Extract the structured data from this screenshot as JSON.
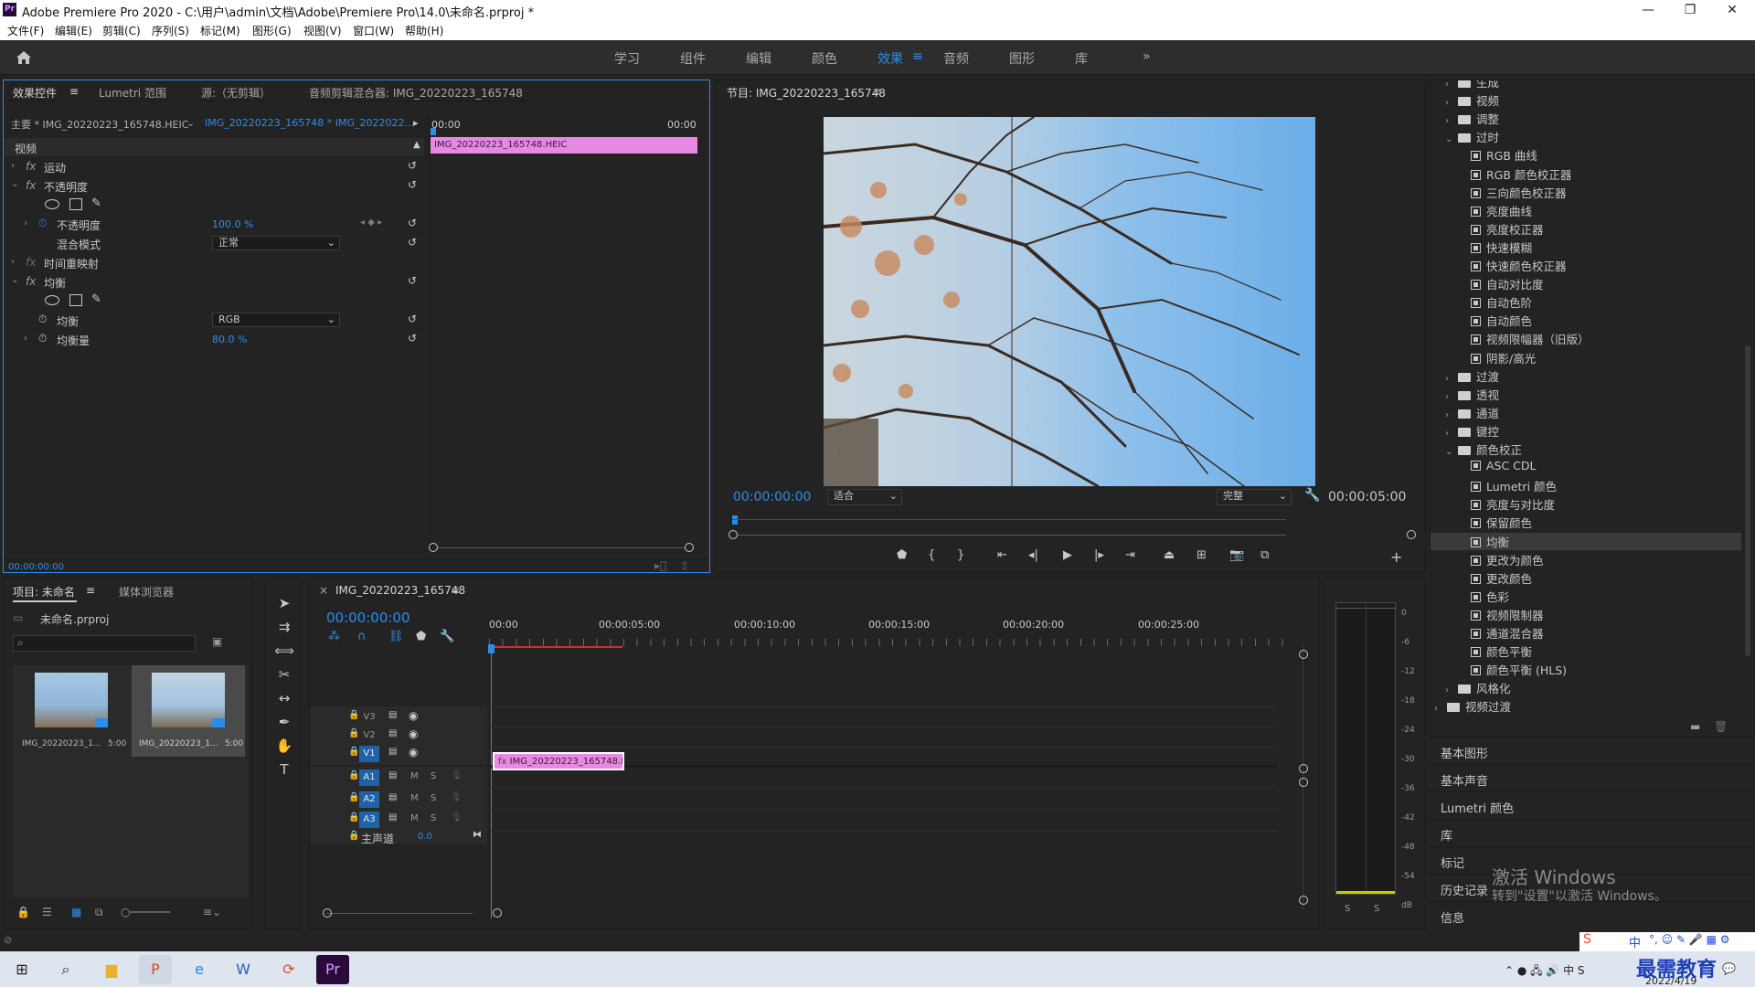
{
  "window": {
    "title": "Adobe Premiere Pro 2020 - C:\\用户\\admin\\文档\\Adobe\\Premiere Pro\\14.0\\未命名.prproj *",
    "app_icon": "Pr"
  },
  "menu": [
    "文件(F)",
    "编辑(E)",
    "剪辑(C)",
    "序列(S)",
    "标记(M)",
    "图形(G)",
    "视图(V)",
    "窗口(W)",
    "帮助(H)"
  ],
  "workspaces": {
    "items": [
      "学习",
      "组件",
      "编辑",
      "颜色",
      "效果",
      "音频",
      "图形",
      "库"
    ],
    "active": "效果",
    "more": "»"
  },
  "effect_controls": {
    "tabs": [
      "效果控件",
      "Lumetri 范围",
      "源:（无剪辑）",
      "音频剪辑混合器: IMG_20220223_165748"
    ],
    "master_clip": "主要 * IMG_20220223_165748.HEIC",
    "seq_clip": "IMG_20220223_165748 * IMG_2022022...",
    "time_start": "00:00",
    "time_end": "00:00",
    "clip_name": "IMG_20220223_165748.HEIC",
    "section_video": "视频",
    "motion": "运动",
    "opacity": "不透明度",
    "opacity_param": "不透明度",
    "opacity_value": "100.0 %",
    "blend_mode_label": "混合模式",
    "blend_mode_value": "正常",
    "time_remap": "时间重映射",
    "equalize": "均衡",
    "equalize_param": "均衡",
    "equalize_value": "RGB",
    "equalize_amount_label": "均衡量",
    "equalize_amount_value": "80.0 %",
    "footer_time": "00:00:00:00"
  },
  "program_monitor": {
    "title": "节目: IMG_20220223_165748",
    "timecode": "00:00:00:00",
    "fit": "适合",
    "quality": "完整",
    "duration": "00:00:05:00"
  },
  "project": {
    "tabs": [
      "项目: 未命名",
      "媒体浏览器"
    ],
    "file": "未命名.prproj",
    "search_placeholder": "",
    "items": [
      {
        "name": "IMG_20220223_1...",
        "dur": "5:00"
      },
      {
        "name": "IMG_20220223_1...",
        "dur": "5:00"
      }
    ]
  },
  "timeline": {
    "tab": "IMG_20220223_165748",
    "timecode": "00:00:00:00",
    "ruler": [
      "00:00",
      "00:00:05:00",
      "00:00:10:00",
      "00:00:15:00",
      "00:00:20:00",
      "00:00:25:00"
    ],
    "video_tracks": [
      "V3",
      "V2",
      "V1"
    ],
    "audio_tracks": [
      "A1",
      "A2",
      "A3"
    ],
    "master": "主声道",
    "master_value": "0.0",
    "clip": "IMG_20220223_165748.H",
    "m": "M",
    "s": "S"
  },
  "audio_meter": {
    "ticks": [
      "0",
      "-6",
      "-12",
      "-18",
      "-24",
      "-30",
      "-36",
      "-42",
      "-48",
      "-54",
      "dB"
    ],
    "s_left": "S",
    "s_right": "S"
  },
  "effects_tree": [
    {
      "label": "生成",
      "type": "folder",
      "level": 1,
      "open": false
    },
    {
      "label": "视频",
      "type": "folder",
      "level": 1,
      "open": false
    },
    {
      "label": "调整",
      "type": "folder",
      "level": 1,
      "open": false
    },
    {
      "label": "过时",
      "type": "folder",
      "level": 1,
      "open": true
    },
    {
      "label": "RGB 曲线",
      "type": "fx",
      "level": 2
    },
    {
      "label": "RGB 颜色校正器",
      "type": "fx",
      "level": 2
    },
    {
      "label": "三向颜色校正器",
      "type": "fx",
      "level": 2
    },
    {
      "label": "亮度曲线",
      "type": "fx",
      "level": 2
    },
    {
      "label": "亮度校正器",
      "type": "fx",
      "level": 2
    },
    {
      "label": "快速模糊",
      "type": "fx",
      "level": 2
    },
    {
      "label": "快速颜色校正器",
      "type": "fx",
      "level": 2
    },
    {
      "label": "自动对比度",
      "type": "fx",
      "level": 2
    },
    {
      "label": "自动色阶",
      "type": "fx",
      "level": 2
    },
    {
      "label": "自动颜色",
      "type": "fx",
      "level": 2
    },
    {
      "label": "视频限幅器（旧版）",
      "type": "fx",
      "level": 2
    },
    {
      "label": "阴影/高光",
      "type": "fx",
      "level": 2
    },
    {
      "label": "过渡",
      "type": "folder",
      "level": 1,
      "open": false
    },
    {
      "label": "透视",
      "type": "folder",
      "level": 1,
      "open": false
    },
    {
      "label": "通道",
      "type": "folder",
      "level": 1,
      "open": false
    },
    {
      "label": "键控",
      "type": "folder",
      "level": 1,
      "open": false
    },
    {
      "label": "颜色校正",
      "type": "folder",
      "level": 1,
      "open": true
    },
    {
      "label": "ASC CDL",
      "type": "fx",
      "level": 2
    },
    {
      "label": "Lumetri 颜色",
      "type": "fx",
      "level": 2
    },
    {
      "label": "亮度与对比度",
      "type": "fx",
      "level": 2
    },
    {
      "label": "保留颜色",
      "type": "fx",
      "level": 2
    },
    {
      "label": "均衡",
      "type": "fx",
      "level": 2,
      "selected": true
    },
    {
      "label": "更改为颜色",
      "type": "fx",
      "level": 2
    },
    {
      "label": "更改颜色",
      "type": "fx",
      "level": 2
    },
    {
      "label": "色彩",
      "type": "fx",
      "level": 2
    },
    {
      "label": "视频限制器",
      "type": "fx",
      "level": 2
    },
    {
      "label": "通道混合器",
      "type": "fx",
      "level": 2
    },
    {
      "label": "颜色平衡",
      "type": "fx",
      "level": 2
    },
    {
      "label": "颜色平衡 (HLS)",
      "type": "fx",
      "level": 2
    },
    {
      "label": "风格化",
      "type": "folder",
      "level": 1,
      "open": false
    },
    {
      "label": "视频过渡",
      "type": "folder",
      "level": 0,
      "open": false
    }
  ],
  "side_sections": [
    "基本图形",
    "基本声音",
    "Lumetri 颜色",
    "库",
    "标记",
    "历史记录",
    "信息"
  ],
  "watermark": {
    "line1": "激活 Windows",
    "line2": "转到\"设置\"以激活 Windows。"
  },
  "taskbar": {
    "time": "2022/4/19",
    "ime": "中",
    "brand": "最需教育"
  },
  "colors": {
    "accent": "#2d8ceb",
    "clip": "#e58ae0",
    "panel": "#232323"
  }
}
